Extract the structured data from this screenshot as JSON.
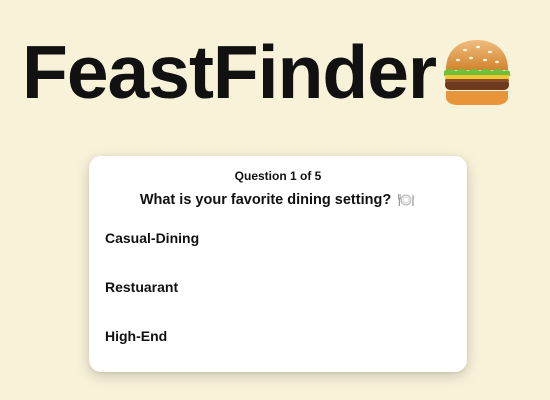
{
  "app": {
    "title": "FeastFinder",
    "logo_icon": "burger-icon"
  },
  "quiz": {
    "counter": "Question 1 of 5",
    "question": "What is your favorite dining setting?",
    "question_icon": "plate-icon",
    "options": [
      {
        "label": "Casual-Dining"
      },
      {
        "label": "Restuarant"
      },
      {
        "label": "High-End"
      }
    ]
  },
  "colors": {
    "background": "#f8f2d9",
    "card": "#ffffff",
    "text": "#111111"
  }
}
